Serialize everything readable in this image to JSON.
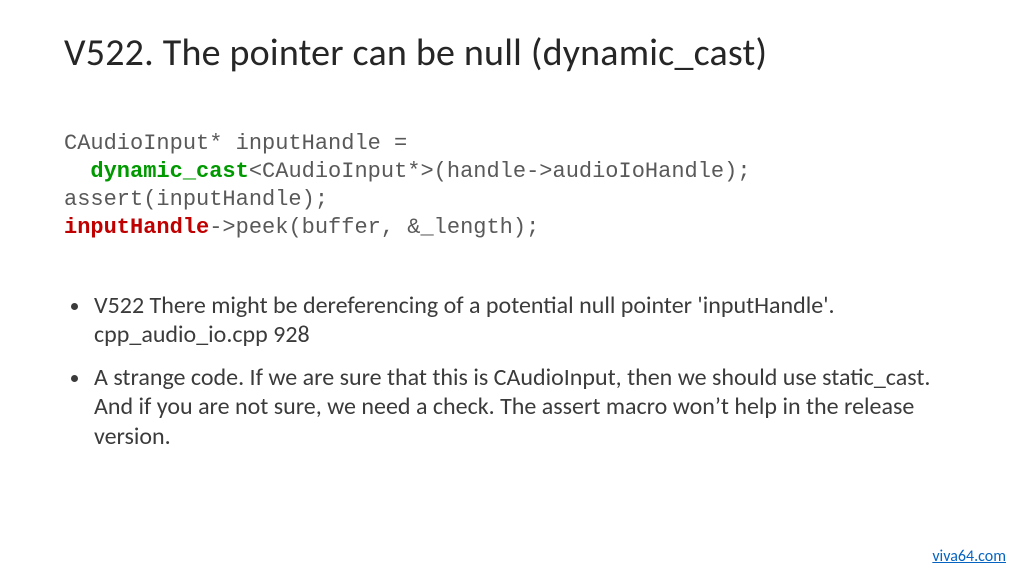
{
  "title": "V522. The pointer can be null (dynamic_cast)",
  "code": {
    "l1a": "CAudioInput* inputHandle =",
    "l2a": "  ",
    "l2b": "dynamic_cast",
    "l2c": "<CAudioInput*>(handle->audioIoHandle);",
    "l3a": "assert(inputHandle);",
    "l4a": "inputHandle",
    "l4b": "->peek(buffer, &_length);"
  },
  "bullets": [
    "V522 There might be dereferencing of a potential null pointer 'inputHandle'. cpp_audio_io.cpp 928",
    "A strange code. If we are sure that this is CAudioInput, then we should use static_cast. And if you are not sure, we need a check. The assert macro won’t help in the release version."
  ],
  "footer_link": "viva64.com"
}
